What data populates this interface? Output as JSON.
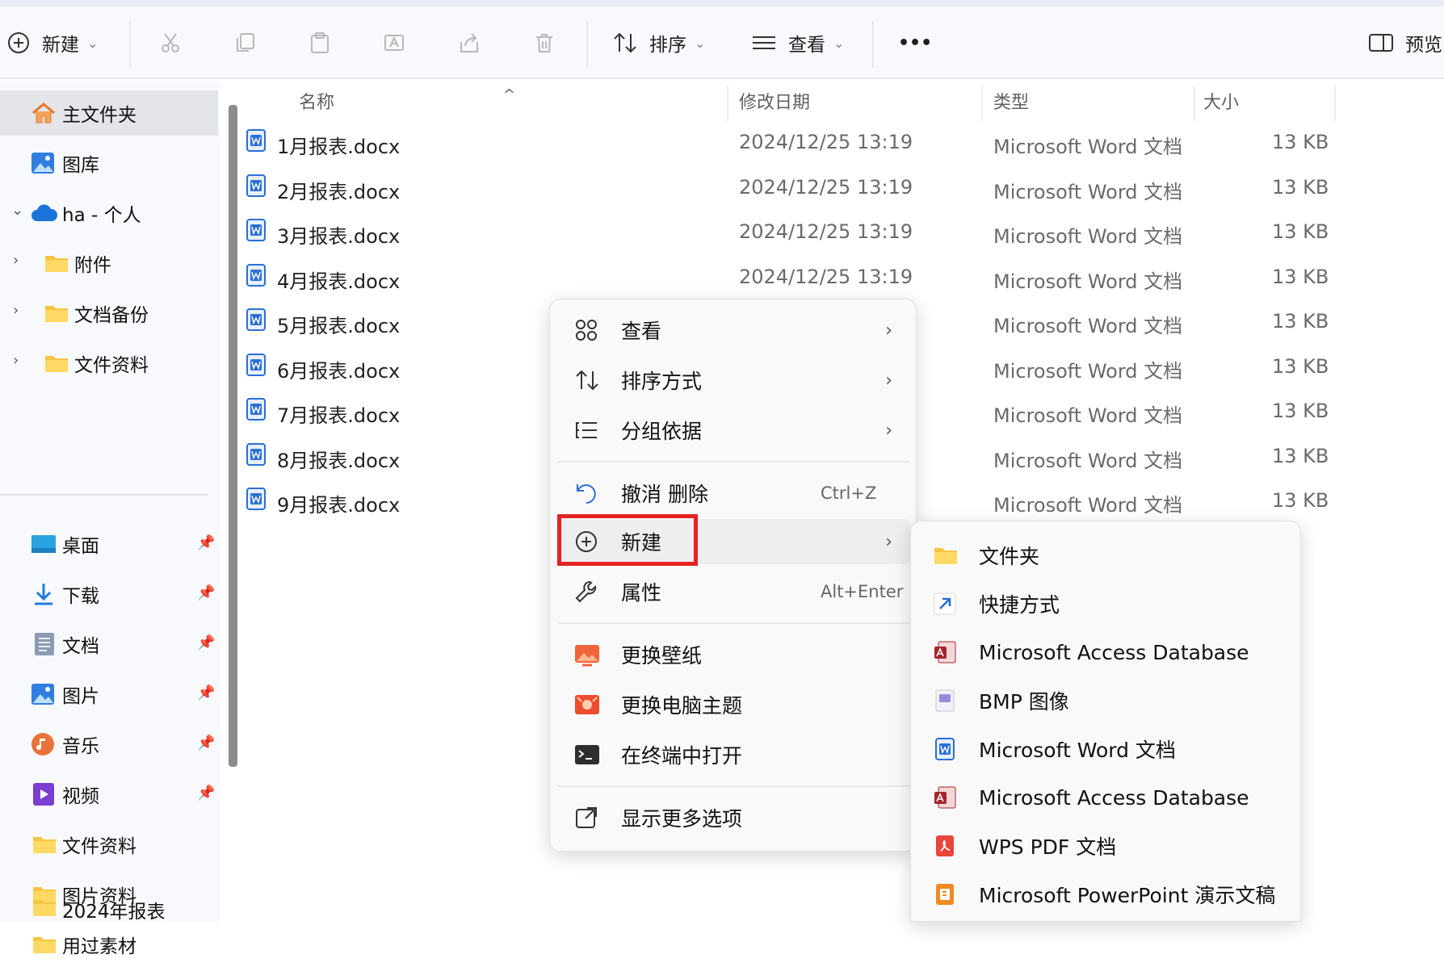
{
  "toolbar": {
    "new_label": "新建",
    "sort_label": "排序",
    "view_label": "查看",
    "more_label": "•••",
    "preview_label": "预览",
    "chevron": "⌄"
  },
  "sidebar": {
    "home": "主文件夹",
    "gallery": "图库",
    "onedrive": "ha - 个人",
    "tree": [
      "附件",
      "文档备份",
      "文件资料"
    ],
    "quick": [
      {
        "label": "桌面",
        "icon": "desktop-icon"
      },
      {
        "label": "下载",
        "icon": "download-icon"
      },
      {
        "label": "文档",
        "icon": "documents-icon"
      },
      {
        "label": "图片",
        "icon": "pictures-icon"
      },
      {
        "label": "音乐",
        "icon": "music-icon"
      },
      {
        "label": "视频",
        "icon": "video-icon"
      }
    ],
    "folders": [
      "文件资料",
      "图片资料",
      "用过素材",
      "2024年报表"
    ],
    "chevron_down": "⌄",
    "chevron_right": "›",
    "pin": "📌"
  },
  "columns": {
    "name": "名称",
    "date": "修改日期",
    "type": "类型",
    "size": "大小",
    "sort_arrow": "^"
  },
  "files": [
    {
      "name": "1月报表.docx",
      "date": "2024/12/25 13:19",
      "type": "Microsoft Word 文档",
      "size": "13 KB"
    },
    {
      "name": "2月报表.docx",
      "date": "2024/12/25 13:19",
      "type": "Microsoft Word 文档",
      "size": "13 KB"
    },
    {
      "name": "3月报表.docx",
      "date": "2024/12/25 13:19",
      "type": "Microsoft Word 文档",
      "size": "13 KB"
    },
    {
      "name": "4月报表.docx",
      "date": "2024/12/25 13:19",
      "type": "Microsoft Word 文档",
      "size": "13 KB"
    },
    {
      "name": "5月报表.docx",
      "date": "",
      "type": "Microsoft Word 文档",
      "size": "13 KB"
    },
    {
      "name": "6月报表.docx",
      "date": "",
      "type": "Microsoft Word 文档",
      "size": "13 KB"
    },
    {
      "name": "7月报表.docx",
      "date": "",
      "type": "Microsoft Word 文档",
      "size": "13 KB"
    },
    {
      "name": "8月报表.docx",
      "date": "",
      "type": "Microsoft Word 文档",
      "size": "13 KB"
    },
    {
      "name": "9月报表.docx",
      "date": "",
      "type": "Microsoft Word 文档",
      "size": "13 KB"
    }
  ],
  "context_menu": {
    "view": "查看",
    "sort": "排序方式",
    "group": "分组依据",
    "undo": "撤消 删除",
    "undo_key": "Ctrl+Z",
    "new": "新建",
    "properties": "属性",
    "properties_key": "Alt+Enter",
    "wallpaper": "更换壁纸",
    "theme": "更换电脑主题",
    "terminal": "在终端中打开",
    "more": "显示更多选项",
    "arrow": "›"
  },
  "submenu": [
    {
      "label": "文件夹",
      "icon": "folder-icon"
    },
    {
      "label": "快捷方式",
      "icon": "shortcut-icon"
    },
    {
      "label": "Microsoft Access Database",
      "icon": "access-icon"
    },
    {
      "label": "BMP 图像",
      "icon": "bmp-icon"
    },
    {
      "label": "Microsoft Word 文档",
      "icon": "word-icon"
    },
    {
      "label": "Microsoft Access Database",
      "icon": "access-icon"
    },
    {
      "label": "WPS PDF 文档",
      "icon": "pdf-icon"
    },
    {
      "label": "Microsoft PowerPoint 演示文稿",
      "icon": "powerpoint-icon"
    }
  ],
  "colors": {
    "accent": "#2b6fd6",
    "highlight": "#e52222",
    "folder": "#f5c542"
  }
}
